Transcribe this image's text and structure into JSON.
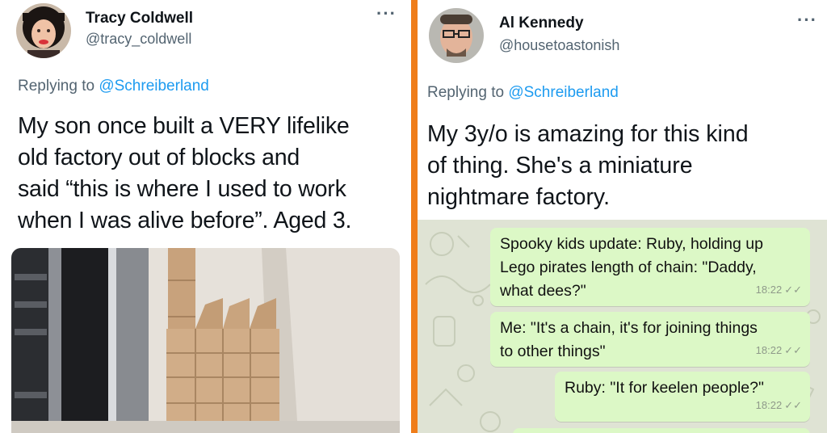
{
  "left_tweet": {
    "name": "Tracy Coldwell",
    "handle": "@tracy_coldwell",
    "more": "···",
    "replying_prefix": "Replying to",
    "replying_to": "@Schreiberland",
    "lines": [
      "My son once built a VERY lifelike",
      "old factory out of blocks and",
      "said “this is where I used to work",
      "when I was alive before”. Aged 3."
    ]
  },
  "right_tweet": {
    "name": "Al Kennedy",
    "handle": "@housetoastonish",
    "more": "···",
    "replying_prefix": "Replying to",
    "replying_to": "@Schreiberland",
    "lines": [
      "My 3y/o is amazing for this kind",
      "of thing. She's a miniature",
      "nightmare factory."
    ]
  },
  "chat": {
    "messages": [
      {
        "text": "Spooky kids update: Ruby, holding up\nLego pirates length of chain: \"Daddy,\nwhat dees?\"",
        "time": "18:22"
      },
      {
        "text": "Me: \"It's a chain, it's for joining things\nto other things\"",
        "time": "18:22"
      },
      {
        "text": "Ruby: \"It for keelen people?\"",
        "time": "18:22"
      }
    ],
    "ticks": "✓✓"
  },
  "colors": {
    "divider": "#ef7d1a",
    "link": "#1d9bf0",
    "bubble": "#dcf8c6",
    "chat_background": "#dfe3d4"
  }
}
